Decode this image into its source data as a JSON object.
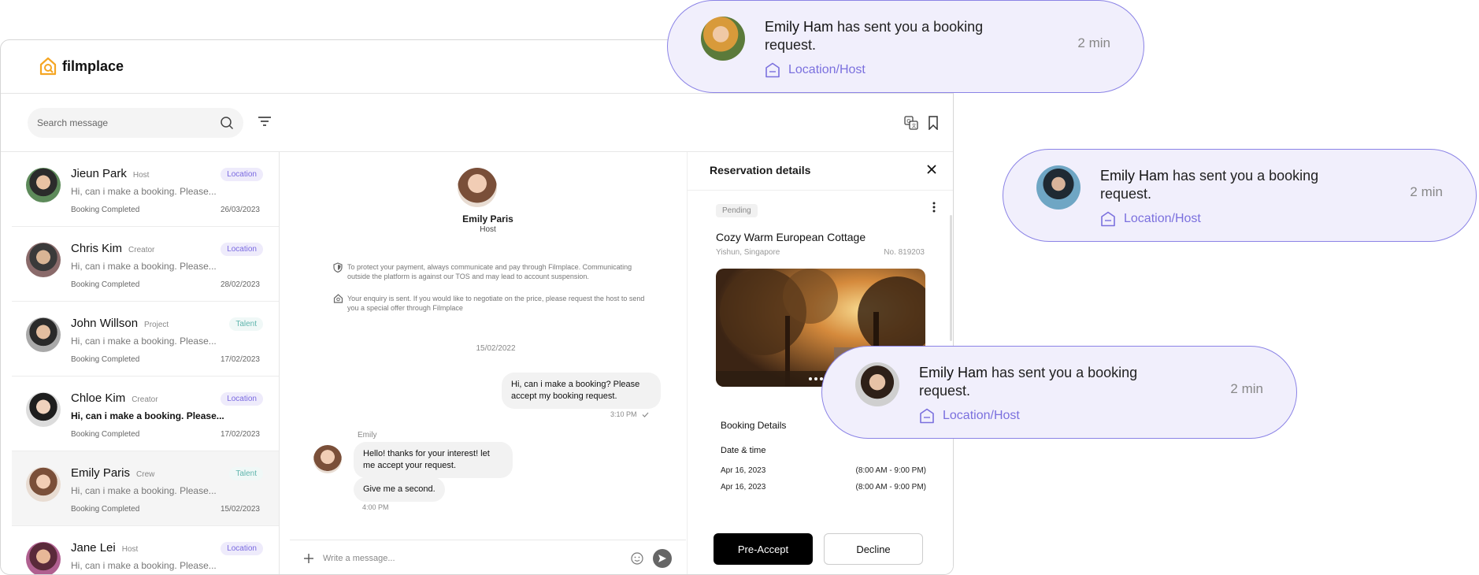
{
  "app": {
    "logo_text": "filmplace"
  },
  "search": {
    "placeholder": "Search message"
  },
  "conversations": [
    {
      "name": "Jieun Park",
      "role": "Host",
      "tag": "Location",
      "tag_type": "loc",
      "preview": "Hi, can i make a booking. Please...",
      "status": "Booking Completed",
      "date": "26/03/2023",
      "unread": false,
      "active": false
    },
    {
      "name": "Chris Kim",
      "role": "Creator",
      "tag": "Location",
      "tag_type": "loc",
      "preview": "Hi, can i make a booking. Please...",
      "status": "Booking Completed",
      "date": "28/02/2023",
      "unread": false,
      "active": false
    },
    {
      "name": "John Willson",
      "role": "Project",
      "tag": "Talent",
      "tag_type": "tal",
      "preview": "Hi, can i make a booking. Please...",
      "status": "Booking Completed",
      "date": "17/02/2023",
      "unread": false,
      "active": false
    },
    {
      "name": "Chloe Kim",
      "role": "Creator",
      "tag": "Location",
      "tag_type": "loc",
      "preview": "Hi, can i make a booking. Please...",
      "status": "Booking Completed",
      "date": "17/02/2023",
      "unread": true,
      "active": false
    },
    {
      "name": "Emily Paris",
      "role": "Crew",
      "tag": "Talent",
      "tag_type": "tal",
      "preview": "Hi, can i make a booking. Please...",
      "status": "Booking Completed",
      "date": "15/02/2023",
      "unread": false,
      "active": true
    },
    {
      "name": "Jane Lei",
      "role": "Host",
      "tag": "Location",
      "tag_type": "loc",
      "preview": "Hi, can i make a booking. Please...",
      "status": "",
      "date": "",
      "unread": false,
      "active": false
    }
  ],
  "chat": {
    "contact_name": "Emily Paris",
    "contact_role": "Host",
    "notice_1": "To protect your payment, always communicate and pay through Filmplace. Communicating outside the platform is against our TOS and may lead to account suspension.",
    "notice_2": "Your enquiry is sent. If you would like to negotiate on the price, please request the host to send you a special offer through Filmplace",
    "date_divider": "15/02/2022",
    "outgoing_message": "Hi, can i make a booking? Please accept my booking request.",
    "outgoing_time": "3:10 PM",
    "incoming_sender": "Emily",
    "incoming_message_1": "Hello! thanks for your interest! let me accept your request.",
    "incoming_message_2": "Give me a second.",
    "incoming_time": "4:00 PM",
    "input_placeholder": "Write a message..."
  },
  "reservation": {
    "title": "Reservation details",
    "status": "Pending",
    "property_name": "Cozy Warm European Cottage",
    "location": "Yishun, Singapore",
    "number": "No. 819203",
    "booking_details_title": "Booking Details",
    "date_time_title": "Date & time",
    "dates": [
      {
        "date": "Apr 16, 2023",
        "time": "(8:00 AM - 9:00 PM)"
      },
      {
        "date": "Apr 16, 2023",
        "time": "(8:00 AM - 9:00 PM)"
      }
    ],
    "accept_label": "Pre-Accept",
    "decline_label": "Decline"
  },
  "notifications": [
    {
      "name": "Emily Ham",
      "text": "has sent you a booking request.",
      "category": "Location/Host",
      "time": "2 min"
    },
    {
      "name": "Emily Ham",
      "text": "has sent you a booking request.",
      "category": "Location/Host",
      "time": "2 min"
    },
    {
      "name": "Emily Ham",
      "text": "has sent you a booking request.",
      "category": "Location/Host",
      "time": "2 min"
    }
  ],
  "colors": {
    "accent": "#7b70de",
    "logo": "#f5a623",
    "toast_bg": "#f1effc",
    "toast_border": "#8b83e6",
    "talent": "#5fb5ad"
  },
  "icons": [
    "logo-icon",
    "search-icon",
    "filter-icon",
    "translate-icon",
    "bookmark-icon",
    "close-icon",
    "more-icon",
    "shield-icon",
    "home-icon",
    "plus-icon",
    "emoji-icon",
    "send-icon",
    "check-icon",
    "location-host-icon"
  ]
}
